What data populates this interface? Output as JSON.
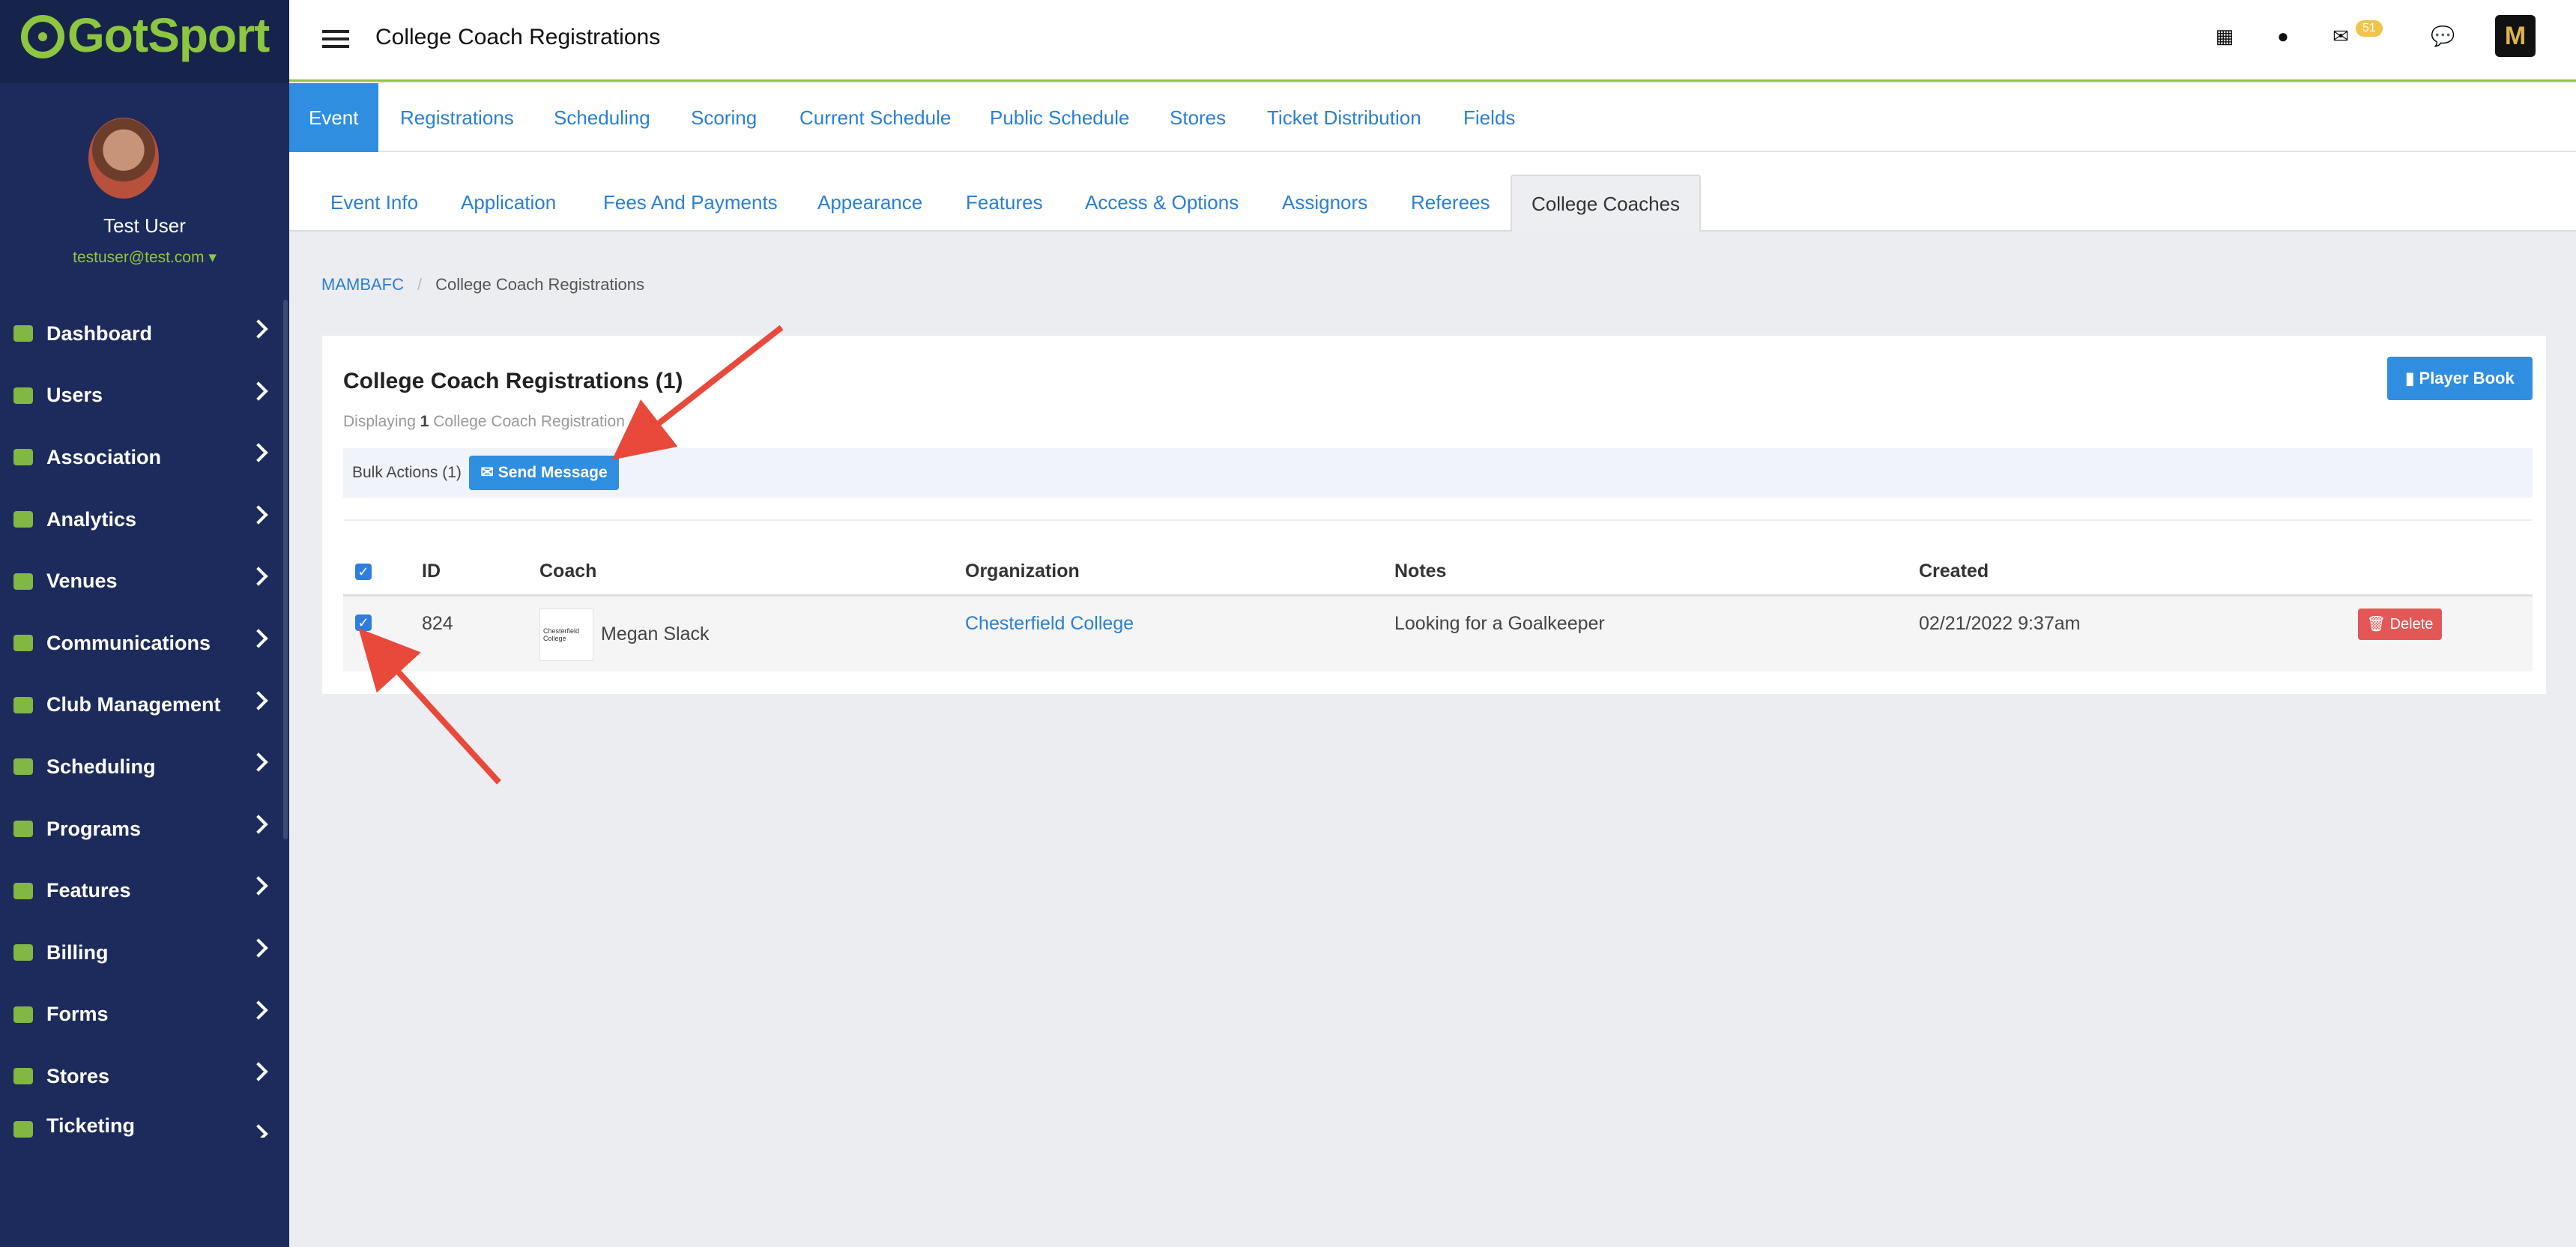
{
  "brand": {
    "name": "GotSport",
    "accent": "#8dc63f"
  },
  "user": {
    "name": "Test User",
    "email": "testuser@test.com"
  },
  "sidebar": {
    "items": [
      {
        "label": "Dashboard",
        "icon": "dashboard-icon"
      },
      {
        "label": "Users",
        "icon": "users-icon"
      },
      {
        "label": "Association",
        "icon": "sitemap-icon"
      },
      {
        "label": "Analytics",
        "icon": "chart-icon"
      },
      {
        "label": "Venues",
        "icon": "home-icon"
      },
      {
        "label": "Communications",
        "icon": "chat-icon"
      },
      {
        "label": "Club Management",
        "icon": "server-icon"
      },
      {
        "label": "Scheduling",
        "icon": "calendar-icon"
      },
      {
        "label": "Programs",
        "icon": "document-icon"
      },
      {
        "label": "Features",
        "icon": "star-icon"
      },
      {
        "label": "Billing",
        "icon": "credit-card-icon"
      },
      {
        "label": "Forms",
        "icon": "file-icon"
      },
      {
        "label": "Stores",
        "icon": "shopping-bag-icon"
      },
      {
        "label": "Ticketing",
        "icon": "ticket-icon"
      }
    ]
  },
  "header": {
    "title": "College Coach Registrations",
    "mail_badge": "51"
  },
  "main_tabs": [
    "Event",
    "Registrations",
    "Scheduling",
    "Scoring",
    "Current Schedule",
    "Public Schedule",
    "Stores",
    "Ticket Distribution",
    "Fields"
  ],
  "sub_tabs": [
    "Event Info",
    "Application",
    "Fees And Payments",
    "Appearance",
    "Features",
    "Access & Options",
    "Assignors",
    "Referees",
    "College Coaches"
  ],
  "breadcrumb": {
    "root": "MAMBAFC",
    "current": "College Coach Registrations"
  },
  "card": {
    "title": "College Coach Registrations (1)",
    "player_book": "Player Book",
    "displaying_prefix": "Displaying",
    "displaying_count": "1",
    "displaying_suffix": "College Coach Registration",
    "bulk_label": "Bulk Actions (1)",
    "send_message": "Send Message"
  },
  "table": {
    "headers": [
      "ID",
      "Coach",
      "Organization",
      "Notes",
      "Created"
    ],
    "rows": [
      {
        "id": "824",
        "coach": "Megan Slack",
        "coach_logo_text": "Chesterfield College",
        "organization": "Chesterfield College",
        "notes": "Looking for a Goalkeeper",
        "created": "02/21/2022 9:37am",
        "delete_label": "Delete"
      }
    ]
  }
}
